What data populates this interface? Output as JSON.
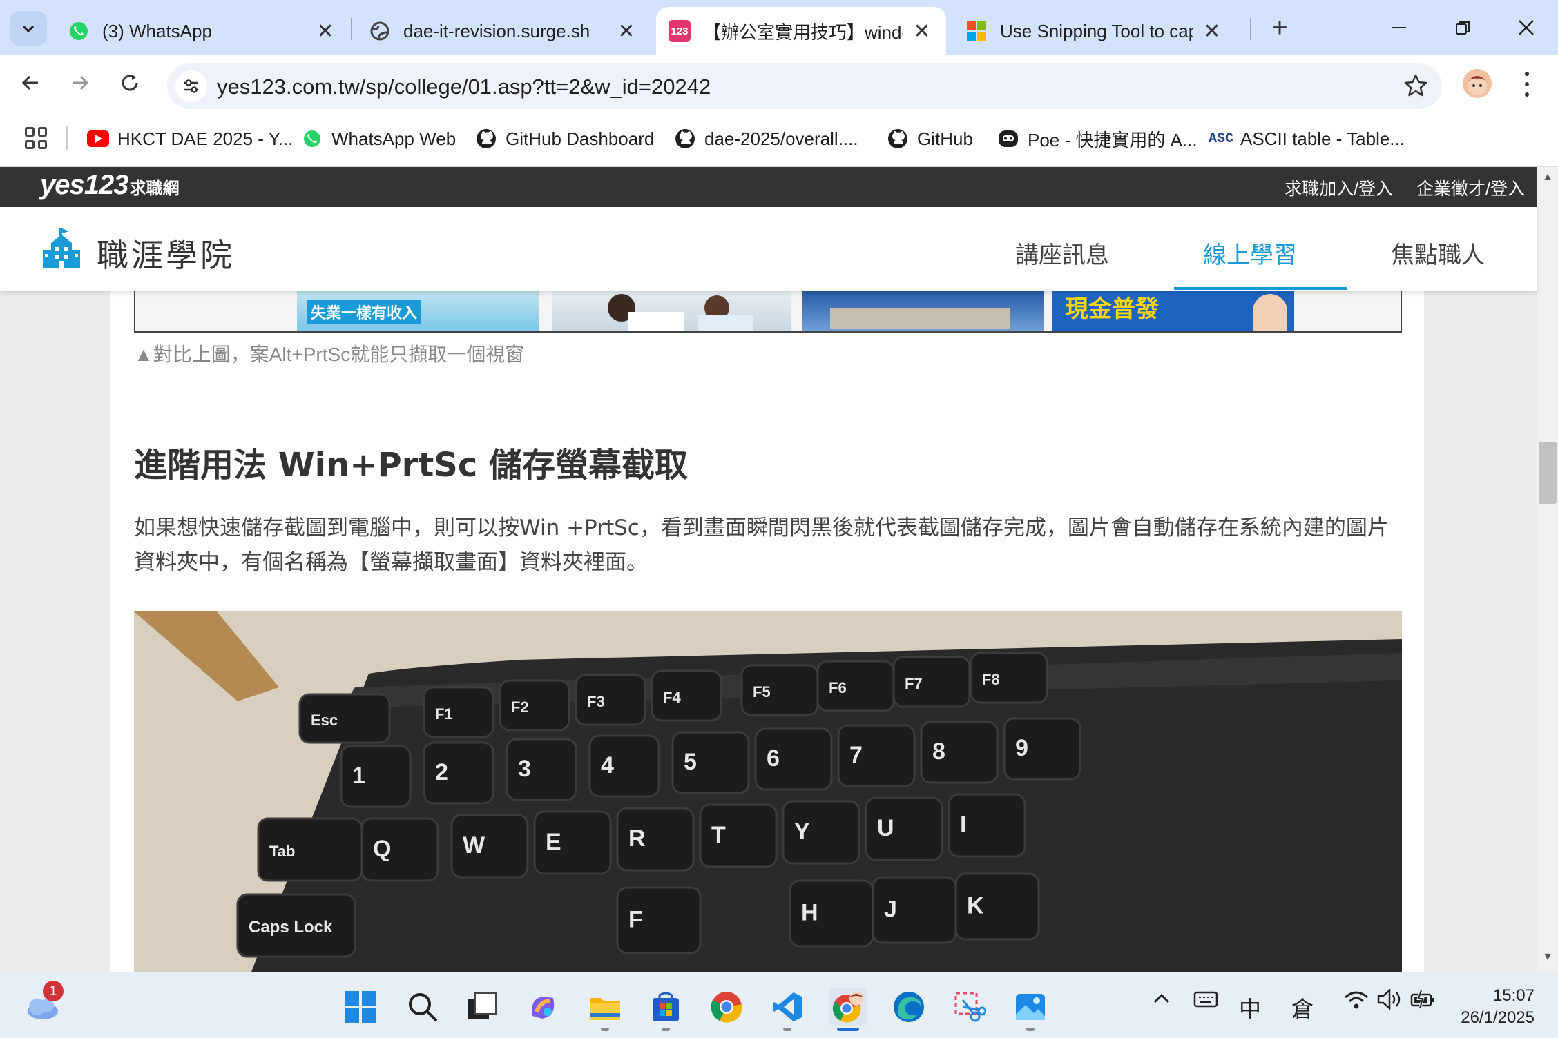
{
  "browser": {
    "tabs": [
      {
        "title": "(3) WhatsApp",
        "icon": "whatsapp-icon"
      },
      {
        "title": "dae-it-revision.surge.sh",
        "icon": "globe-icon"
      },
      {
        "title": "【辦公室實用技巧】windo",
        "icon": "yes123-icon",
        "active": true
      },
      {
        "title": "Use Snipping Tool to captu",
        "icon": "microsoft-icon"
      }
    ],
    "url": "yes123.com.tw/sp/college/01.asp?tt=2&w_id=20242",
    "bookmarks": [
      {
        "label": "HKCT DAE 2025 - Y...",
        "icon": "youtube-icon"
      },
      {
        "label": "WhatsApp Web",
        "icon": "whatsapp-icon"
      },
      {
        "label": "GitHub Dashboard",
        "icon": "github-icon"
      },
      {
        "label": "dae-2025/overall....",
        "icon": "github-icon"
      },
      {
        "label": "GitHub",
        "icon": "github-icon"
      },
      {
        "label": "Poe - 快捷實用的 A...",
        "icon": "poe-icon"
      },
      {
        "label": "ASCII table - Table...",
        "icon": "ascii-icon"
      }
    ]
  },
  "site": {
    "logo": "yes123",
    "logo_suffix": "求職網",
    "top_links": [
      "求職加入/登入",
      "企業徵才/登入"
    ],
    "brand": "職涯學院",
    "nav": [
      "講座訊息",
      "線上學習",
      "焦點職人"
    ],
    "prev_images": [
      "失業一樣有收入",
      "現金普發"
    ]
  },
  "article": {
    "caption": "▲對比上圖，案Alt+PrtSc就能只擷取一個視窗",
    "heading": "進階用法 Win+PrtSc 儲存螢幕截取",
    "paragraph": "如果想快速儲存截圖到電腦中，則可以按Win +PrtSc，看到畫面瞬間閃黑後就代表截圖儲存完成，圖片會自動儲存在系統內建的圖片資料夾中，有個名稱為【螢幕擷取畫面】資料夾裡面。",
    "keys": [
      "Esc",
      "F1",
      "F2",
      "F3",
      "F4",
      "F5",
      "F6",
      "F7",
      "F8",
      "Tab",
      "Caps Lock",
      "Q",
      "W",
      "E",
      "R",
      "T",
      "Y",
      "U",
      "I",
      "F",
      "H",
      "J",
      "K",
      "1",
      "2",
      "3",
      "4",
      "5",
      "6",
      "7",
      "8",
      "9"
    ]
  },
  "taskbar": {
    "weather_badge": "1",
    "ime": "中",
    "ime2": "倉",
    "time": "15:07",
    "date": "26/1/2025"
  }
}
